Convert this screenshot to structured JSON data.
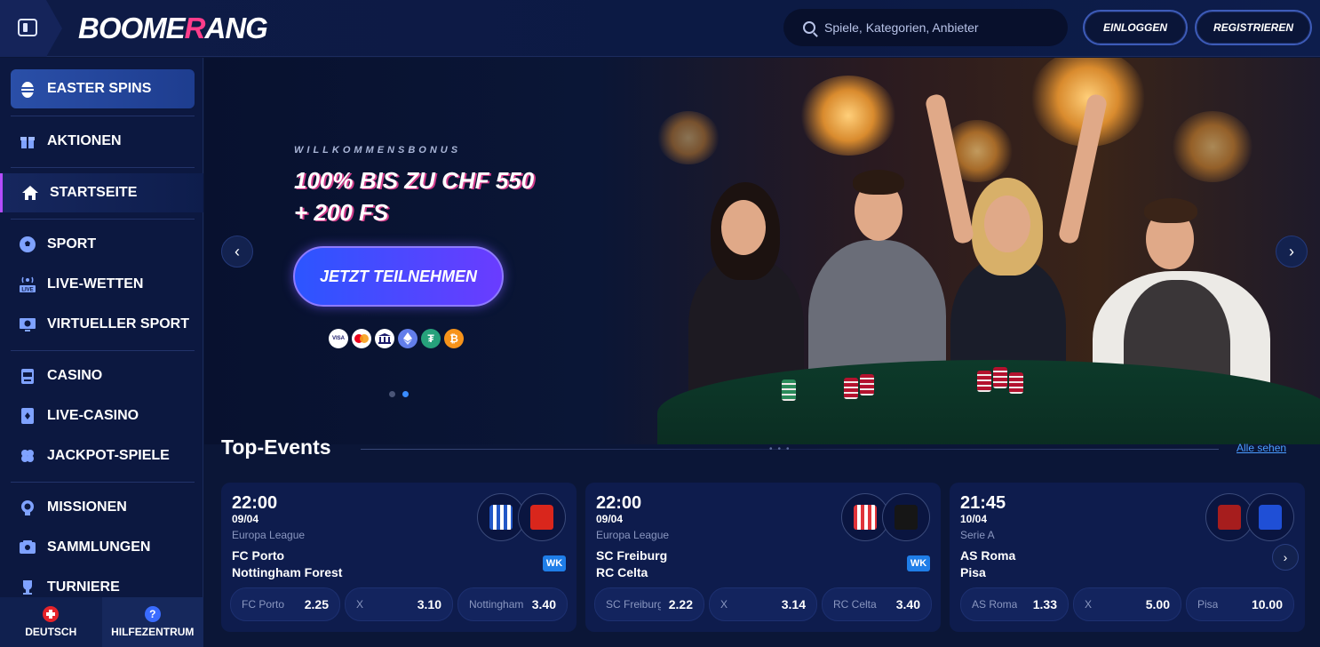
{
  "header": {
    "logo": "BOOMERANG",
    "search_placeholder": "Spiele, Kategorien, Anbieter",
    "login": "EINLOGGEN",
    "register": "REGISTRIEREN"
  },
  "sidebar": {
    "items": [
      {
        "label": "EASTER SPINS",
        "icon": "egg-icon"
      },
      {
        "label": "AKTIONEN",
        "icon": "gift-icon"
      },
      {
        "label": "STARTSEITE",
        "icon": "home-icon"
      },
      {
        "label": "SPORT",
        "icon": "soccer-ball-icon"
      },
      {
        "label": "LIVE-WETTEN",
        "icon": "live-broadcast-icon"
      },
      {
        "label": "VIRTUELLER SPORT",
        "icon": "virtual-sport-icon"
      },
      {
        "label": "CASINO",
        "icon": "slot-machine-icon"
      },
      {
        "label": "LIVE-CASINO",
        "icon": "card-icon"
      },
      {
        "label": "JACKPOT-SPIELE",
        "icon": "clover-icon"
      },
      {
        "label": "MISSIONEN",
        "icon": "medal-icon"
      },
      {
        "label": "SAMMLUNGEN",
        "icon": "collection-icon"
      },
      {
        "label": "TURNIERE",
        "icon": "trophy-icon"
      }
    ],
    "language": "DEUTSCH",
    "help": "HILFEZENTRUM"
  },
  "banner": {
    "subtitle": "WILLKOMMENSBONUS",
    "title_line1": "100% BIS ZU CHF 550",
    "title_line2": "+ 200 FS",
    "cta": "JETZT TEILNEHMEN",
    "payment_icons": [
      "VISA",
      "mastercard",
      "bank",
      "ethereum",
      "tether",
      "bitcoin"
    ],
    "active_slide": 1,
    "slide_count": 2
  },
  "events": {
    "title": "Top-Events",
    "see_all": "Alle sehen",
    "cards": [
      {
        "time": "22:00",
        "date": "09/04",
        "league": "Europa League",
        "team1": "FC Porto",
        "team2": "Nottingham Forest",
        "badge": "WK",
        "odds": [
          {
            "label": "FC Porto",
            "value": "2.25"
          },
          {
            "label": "X",
            "value": "3.10"
          },
          {
            "label": "Nottingham Forest",
            "value": "3.40"
          }
        ]
      },
      {
        "time": "22:00",
        "date": "09/04",
        "league": "Europa League",
        "team1": "SC Freiburg",
        "team2": "RC Celta",
        "badge": "WK",
        "odds": [
          {
            "label": "SC Freiburg",
            "value": "2.22"
          },
          {
            "label": "X",
            "value": "3.14"
          },
          {
            "label": "RC Celta",
            "value": "3.40"
          }
        ]
      },
      {
        "time": "21:45",
        "date": "10/04",
        "league": "Serie A",
        "team1": "AS Roma",
        "team2": "Pisa",
        "badge": "",
        "odds": [
          {
            "label": "AS Roma",
            "value": "1.33"
          },
          {
            "label": "X",
            "value": "5.00"
          },
          {
            "label": "Pisa",
            "value": "10.00"
          }
        ]
      }
    ]
  }
}
